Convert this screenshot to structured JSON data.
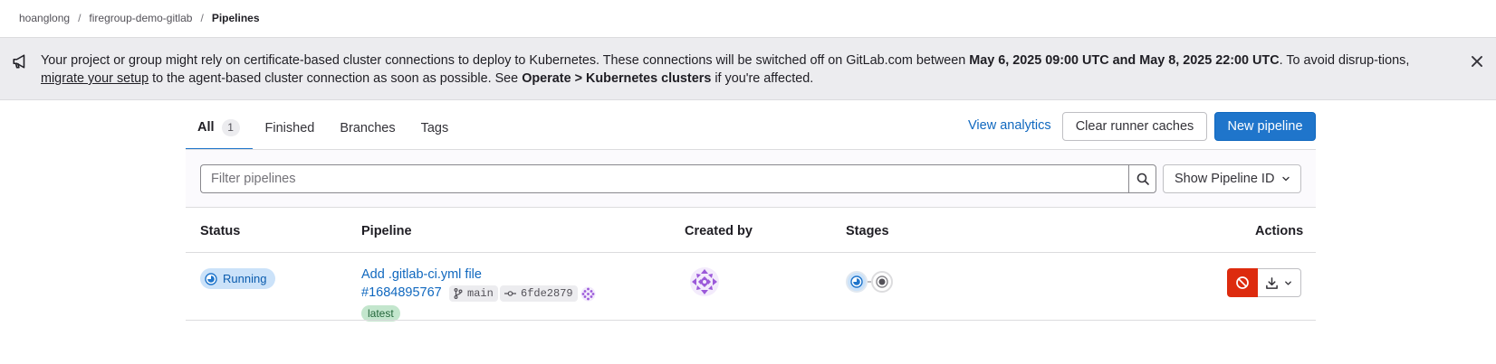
{
  "breadcrumb": {
    "items": [
      "hoanglong",
      "firegroup-demo-gitlab",
      "Pipelines"
    ],
    "separator": "/"
  },
  "banner": {
    "icon": "megaphone-icon",
    "text_1": "Your project or group might rely on certificate-based cluster connections to deploy to Kubernetes. These connections will be switched off on GitLab.com between ",
    "bold_dates": "May 6, 2025 09:00 UTC and May 8, 2025 22:00 UTC",
    "text_2": ". To avoid disrup-tions, ",
    "link": "migrate your setup",
    "text_3": " to the agent-based cluster connection as soon as possible. See ",
    "bold_path": "Operate > Kubernetes clusters",
    "text_4": " if you're affected."
  },
  "tabs": [
    {
      "label": "All",
      "count": "1",
      "active": true
    },
    {
      "label": "Finished"
    },
    {
      "label": "Branches"
    },
    {
      "label": "Tags"
    }
  ],
  "header_actions": {
    "view_analytics": "View analytics",
    "clear_runner_caches": "Clear runner caches",
    "new_pipeline": "New pipeline"
  },
  "filter": {
    "placeholder": "Filter pipelines",
    "show_id_label": "Show Pipeline ID"
  },
  "table": {
    "headers": [
      "Status",
      "Pipeline",
      "Created by",
      "Stages",
      "Actions"
    ],
    "rows": [
      {
        "status": "Running",
        "title": "Add .gitlab-ci.yml file",
        "id": "#1684895767",
        "branch": "main",
        "commit": "6fde2879",
        "badge": "latest",
        "stages": [
          "running",
          "pending"
        ]
      }
    ]
  },
  "colors": {
    "primary": "#1f75cb",
    "link": "#1068bf",
    "danger": "#dd2b0e",
    "running_bg": "#cbe2f9",
    "latest_bg": "#c3e6cd",
    "avatar": "#9b59d9"
  }
}
